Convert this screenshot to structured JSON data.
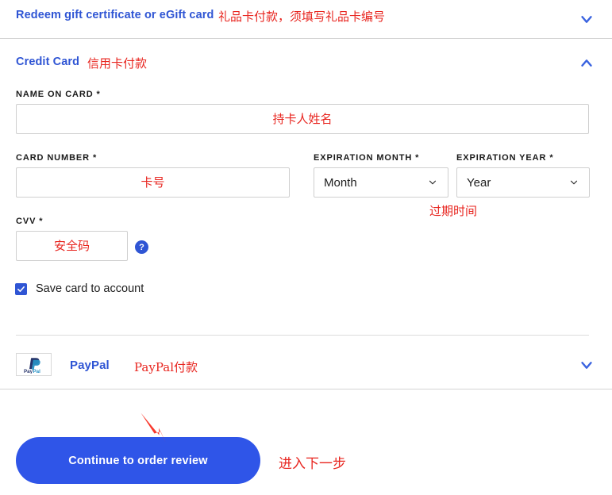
{
  "sections": {
    "gift_card": {
      "title": "Redeem gift certificate or eGift card",
      "annotation": "礼品卡付款，须填写礼品卡编号",
      "chevron": "chevron-down-icon"
    },
    "credit_card": {
      "title": "Credit Card",
      "annotation": "信用卡付款",
      "chevron": "chevron-up-icon"
    },
    "paypal": {
      "title": "PayPal",
      "annotation": "PayPal付款",
      "chevron": "chevron-down-icon",
      "logo_alt": "paypal-logo"
    }
  },
  "form": {
    "name_on_card": {
      "label": "NAME ON CARD",
      "required_mark": "*",
      "value": "",
      "placeholder": "持卡人姓名"
    },
    "card_number": {
      "label": "CARD NUMBER",
      "required_mark": "*",
      "value": "",
      "placeholder": "卡号"
    },
    "expiration_month": {
      "label": "EXPIRATION MONTH",
      "required_mark": "*",
      "selected": "Month"
    },
    "expiration_year": {
      "label": "EXPIRATION YEAR",
      "required_mark": "*",
      "selected": "Year"
    },
    "expiration_annotation": "过期时间",
    "cvv": {
      "label": "CVV",
      "required_mark": "*",
      "value": "",
      "placeholder": "安全码",
      "help_glyph": "?"
    },
    "save_card": {
      "label": "Save card to account",
      "checked": true
    }
  },
  "footer": {
    "continue_label": "Continue to order review",
    "continue_annotation": "进入下一步",
    "arrow": "red-arrow-annotation"
  },
  "colors": {
    "accent_blue": "#2f55d4",
    "button_blue": "#2f55e8",
    "annotation_red": "#e8251f",
    "border_grey": "#cfcfcf",
    "divider_grey": "#d4d4d4"
  }
}
